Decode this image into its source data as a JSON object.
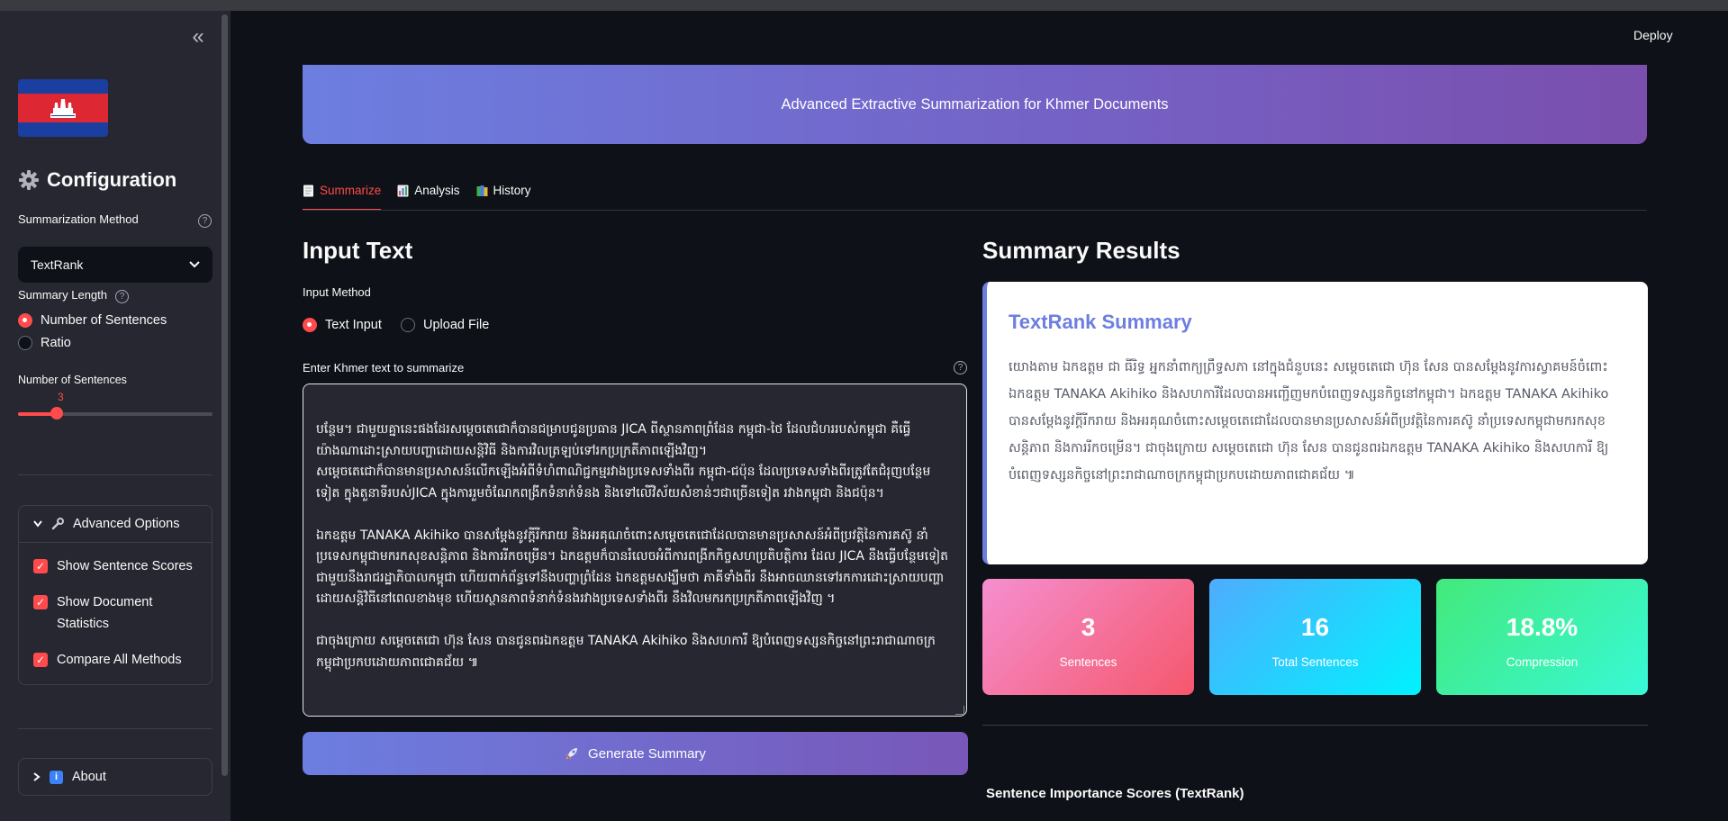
{
  "app": {
    "deploy_label": "Deploy",
    "banner_text": "Advanced Extractive Summarization for Khmer Documents"
  },
  "sidebar": {
    "collapse_icon": "double-chevron-left-icon",
    "flag": "cambodia-flag",
    "config_title": "Configuration",
    "method_label": "Summarization Method",
    "method_value": "TextRank",
    "length_label": "Summary Length",
    "length_options": [
      {
        "label": "Number of Sentences",
        "selected": true
      },
      {
        "label": "Ratio",
        "selected": false
      }
    ],
    "num_sentences_label": "Number of Sentences",
    "num_sentences_value": "3",
    "slider_fraction": 0.2,
    "advanced_label": "Advanced Options",
    "advanced_options": [
      {
        "label": "Show Sentence Scores",
        "checked": true
      },
      {
        "label": "Show Document Statistics",
        "checked": true
      },
      {
        "label": "Compare All Methods",
        "checked": true
      }
    ],
    "about_label": "About"
  },
  "tabs": [
    {
      "label": "Summarize",
      "active": true,
      "icon": "document-icon"
    },
    {
      "label": "Analysis",
      "active": false,
      "icon": "bar-chart-icon"
    },
    {
      "label": "History",
      "active": false,
      "icon": "books-icon"
    }
  ],
  "input": {
    "heading": "Input Text",
    "method_label": "Input Method",
    "method_options": [
      {
        "label": "Text Input",
        "selected": true
      },
      {
        "label": "Upload File",
        "selected": false
      }
    ],
    "textarea_label": "Enter Khmer text to summarize",
    "text": "បន្ថែម។ ជាមួយគ្នានេះផងដែរសម្តេចតេជោក៏បានជម្រាបជូនប្រធាន JICA ពីស្ថានភាពព្រំដែន កម្ពុជា-ថៃ ដែលជំហររបស់កម្ពុជា គឺធ្វើយ៉ាងណាដោះស្រាយបញ្ហាដោយសន្តិវិធី និងការវិលត្រឡប់ទៅរកប្រក្រតីភាពឡើងវិញ។\nសម្តេចតេជោក៏បានមានប្រសាសន៍លើកឡើងអំពីទំហំពាណិជ្ជកម្មរវាងប្រទេសទាំងពីរ កម្ពុជា-ជប៉ុន ដែលប្រទេសទាំងពីរត្រូវតែជំរុញបន្ថែមទៀត ក្នុងតួនាទីរបស់JICA ក្នុងការរួមចំណែកពង្រីកទំនាក់ទំនង និងទៅលើវិស័យសំខាន់ៗជាច្រើនទៀត រវាងកម្ពុជា និងជប៉ុន។\n\nឯកឧត្តម TANAKA Akihiko បានសម្តែងនូវក្តីរីករាយ និងអរគុណចំពោះសម្តេចតេជោដែលបានមានប្រសាសន៍អំពីប្រវត្តិនៃការគស៊ូ នាំប្រទេសកម្ពុជាមករកសុខសន្តិភាព និងការរីកចម្រើន។ ឯកឧត្តមក៏បានរំលេចអំពីការពង្រីកកិច្ចសហប្រតិបត្តិការ ដែល JICA នឹងធ្វើបន្ថែមទៀត ជាមួយនឹងរាជរដ្ឋាភិបាលកម្ពុជា ហើយពាក់ព័ន្ធទៅនឹងបញ្ហាព្រំដែន ឯកឧត្តមសង្ឃឹមថា ភាគីទាំងពីរ នឹងអាចឈានទៅរកការដោះស្រាយបញ្ហាដោយសន្តិវិធីនៅពេលខាងមុខ ហើយស្ថានភាពទំនាក់ទំនងរវាងប្រទេសទាំងពីរ នឹងវិលមករកប្រក្រតីភាពឡើងវិញ ។\n\nជាចុងក្រោយ សម្តេចតេជោ ហ៊ុន សែន បានជូនពរឯកឧត្តម TANAKA Akihiko និងសហការី ឱ្យបំពេញទស្សនកិច្ចនៅព្រះរាជាណាចក្រកម្ពុជាប្រកបដោយភាពជោគជ័យ ៕",
    "generate_label": "Generate Summary"
  },
  "results": {
    "heading": "Summary Results",
    "card_title": "TextRank Summary",
    "summary_text": "យោងតាម ឯកឧត្តម ជា ធីរិទ្ធ អ្នកនាំពាក្យព្រឹទ្ធសភា នៅក្នុងជំនួបនេះ សម្តេចតេជោ ហ៊ុន សែន បានសម្តែងនូវការស្វាគមន៍ចំពោះឯកឧត្តម TANAKA Akihiko និងសហការីដែលបានអញ្ជើញមកបំពេញទស្សនកិច្ចនៅកម្ពុជា។ ឯកឧត្តម TANAKA Akihiko បានសម្តែងនូវក្តីរីករាយ និងអរគុណចំពោះសម្តេចតេជោដែលបានមានប្រសាសន៍អំពីប្រវត្តិនៃការគស៊ូ នាំប្រទេសកម្ពុជាមករកសុខសន្តិភាព និងការរីកចម្រើន។ ជាចុងក្រោយ សម្តេចតេជោ ហ៊ុន សែន បានជូនពរឯកឧត្តម TANAKA Akihiko និងសហការី ឱ្យបំពេញទស្សនកិច្ចនៅព្រះរាជាណាចក្រកម្ពុជាប្រកបដោយភាពជោគជ័យ ៕",
    "stats": [
      {
        "value": "3",
        "label": "Sentences",
        "gradient": [
          "#f58fd0",
          "#f5576c"
        ]
      },
      {
        "value": "16",
        "label": "Total Sentences",
        "gradient": [
          "#4facfe",
          "#00f2fe"
        ]
      },
      {
        "value": "18.8%",
        "label": "Compression",
        "gradient": [
          "#43e97b",
          "#38f9d7"
        ]
      }
    ],
    "scores_title": "Sentence Importance Scores (TextRank)"
  },
  "colors": {
    "accent": "#ff4b4b",
    "brand": "#6c7ee0"
  }
}
